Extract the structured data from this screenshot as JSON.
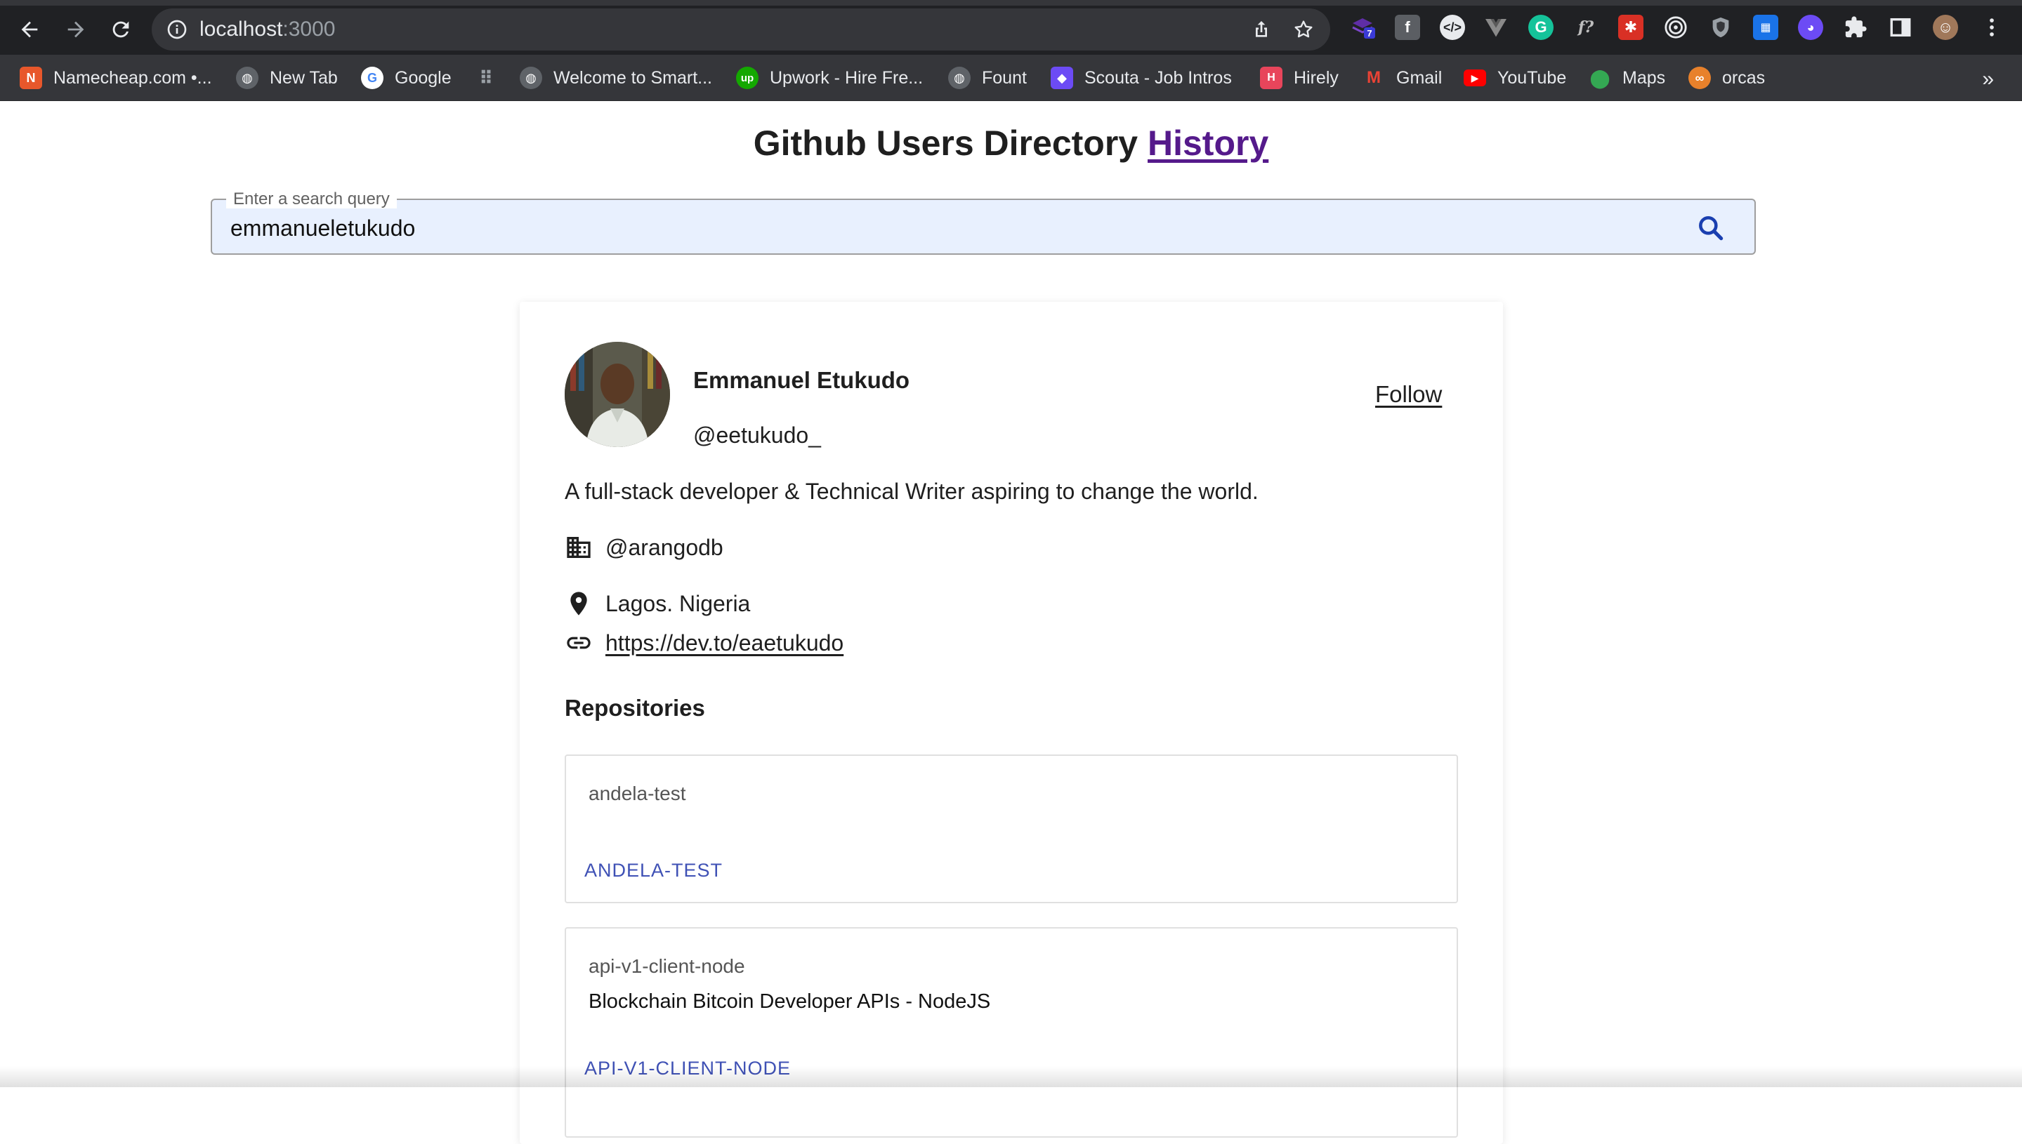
{
  "browser": {
    "url_host": "localhost",
    "url_port": ":3000",
    "extensions": [
      {
        "icon": "stack-extension-icon",
        "badge": "7",
        "color": "#5f2ea6"
      },
      {
        "icon": "facebook-icon",
        "color": "#5b5e63"
      },
      {
        "icon": "code-extension-icon",
        "color": "#e8eaed"
      },
      {
        "icon": "vue-devtools-icon",
        "color": "#8a8a8a"
      },
      {
        "icon": "grammarly-icon",
        "color": "#15c39a"
      },
      {
        "icon": "fx-extension-icon",
        "color": "#bdbdbd"
      },
      {
        "icon": "red-extension-icon",
        "color": "#d93025"
      },
      {
        "icon": "target-extension-icon",
        "color": "#e8eaed"
      },
      {
        "icon": "shield-extension-icon",
        "color": "#9aa0a6"
      },
      {
        "icon": "blue-extension-icon",
        "color": "#1a73e8"
      },
      {
        "icon": "purple-extension-icon",
        "color": "#6c4bf5"
      },
      {
        "icon": "puzzle-icon",
        "color": "#e8eaed"
      },
      {
        "icon": "side-panel-icon",
        "color": "#e8eaed"
      },
      {
        "icon": "profile-avatar-icon",
        "color": "#a0785a"
      },
      {
        "icon": "more-vert-icon",
        "color": "#e8eaed"
      }
    ]
  },
  "bookmarks": [
    {
      "label": "Namecheap.com •...",
      "icon": "namecheap-icon",
      "color": "#e8572b"
    },
    {
      "label": "New Tab",
      "icon": "globe-icon",
      "color": "#5f6368"
    },
    {
      "label": "Google",
      "icon": "google-icon",
      "color": "#ffffff"
    },
    {
      "label": "",
      "icon": "apps-grid-icon",
      "color": "#9aa0a6"
    },
    {
      "label": "Welcome to Smart...",
      "icon": "globe-icon",
      "color": "#5f6368"
    },
    {
      "label": "Upwork - Hire Fre...",
      "icon": "upwork-icon",
      "color": "#14a800"
    },
    {
      "label": "Fount",
      "icon": "globe-icon",
      "color": "#5f6368"
    },
    {
      "label": "Scouta - Job Intros",
      "icon": "scouta-icon",
      "color": "#6c4bf5"
    },
    {
      "label": "Hirely",
      "icon": "hirely-icon",
      "color": "#e8455b"
    },
    {
      "label": "Gmail",
      "icon": "gmail-icon",
      "color": "#ea4335"
    },
    {
      "label": "YouTube",
      "icon": "youtube-icon",
      "color": "#ff0000"
    },
    {
      "label": "Maps",
      "icon": "maps-icon",
      "color": "#34a853"
    },
    {
      "label": "orcas",
      "icon": "orcas-icon",
      "color": "#e8812b"
    }
  ],
  "bookmarks_more": "»",
  "page": {
    "title": "Github Users Directory",
    "history_link": "History",
    "search": {
      "legend": "Enter a search query",
      "value": "emmanueletukudo"
    }
  },
  "profile": {
    "name": "Emmanuel Etukudo",
    "handle": "@eetukudo_",
    "follow_label": "Follow",
    "bio": "A full-stack developer & Technical Writer aspiring to change the world.",
    "company": "@arangodb",
    "location": "Lagos. Nigeria",
    "blog": "https://dev.to/eaetukudo"
  },
  "repositories": {
    "heading": "Repositories",
    "items": [
      {
        "name": "andela-test",
        "description": "",
        "link_label": "ANDELA-TEST"
      },
      {
        "name": "api-v1-client-node",
        "description": "Blockchain Bitcoin Developer APIs - NodeJS",
        "link_label": "API-V1-CLIENT-NODE"
      }
    ]
  },
  "colors": {
    "chrome_bg": "#202124",
    "bookmarks_bg": "#35363a",
    "history_link": "#551a8b",
    "search_bg": "#e8f0fe",
    "search_icon": "#1a3fb0",
    "repo_link": "#3f51b5"
  }
}
